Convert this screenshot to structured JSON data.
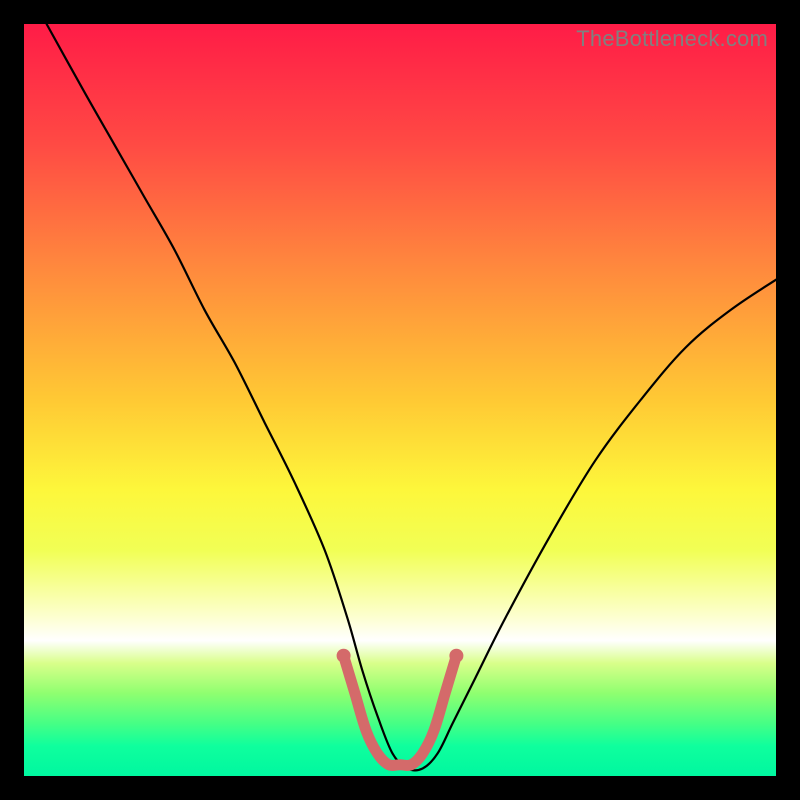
{
  "watermark": "TheBottleneck.com",
  "chart_data": {
    "type": "line",
    "title": "",
    "xlabel": "",
    "ylabel": "",
    "xlim": [
      0,
      100
    ],
    "ylim": [
      0,
      100
    ],
    "grid": false,
    "series": [
      {
        "name": "bottleneck-curve",
        "color": "#000000",
        "x": [
          3,
          8,
          12,
          16,
          20,
          24,
          28,
          32,
          36,
          40,
          43,
          45,
          47,
          49,
          51,
          53,
          55,
          57,
          60,
          64,
          70,
          76,
          82,
          88,
          94,
          100
        ],
        "values": [
          100,
          91,
          84,
          77,
          70,
          62,
          55,
          47,
          39,
          30,
          21,
          14,
          8,
          3,
          1,
          1,
          3,
          7,
          13,
          21,
          32,
          42,
          50,
          57,
          62,
          66
        ]
      },
      {
        "name": "valley-highlight",
        "color": "#d46a6a",
        "x": [
          42.5,
          44,
          45.5,
          47,
          48.5,
          50,
          51.5,
          53,
          54.5,
          56,
          57.5
        ],
        "values": [
          16,
          11,
          6,
          3,
          1.5,
          1.5,
          1.5,
          3,
          6,
          11,
          16
        ]
      }
    ],
    "background_gradient": {
      "top": "#ff1c47",
      "mid": "#fdf73b",
      "bottom": "#00f7a0"
    }
  }
}
